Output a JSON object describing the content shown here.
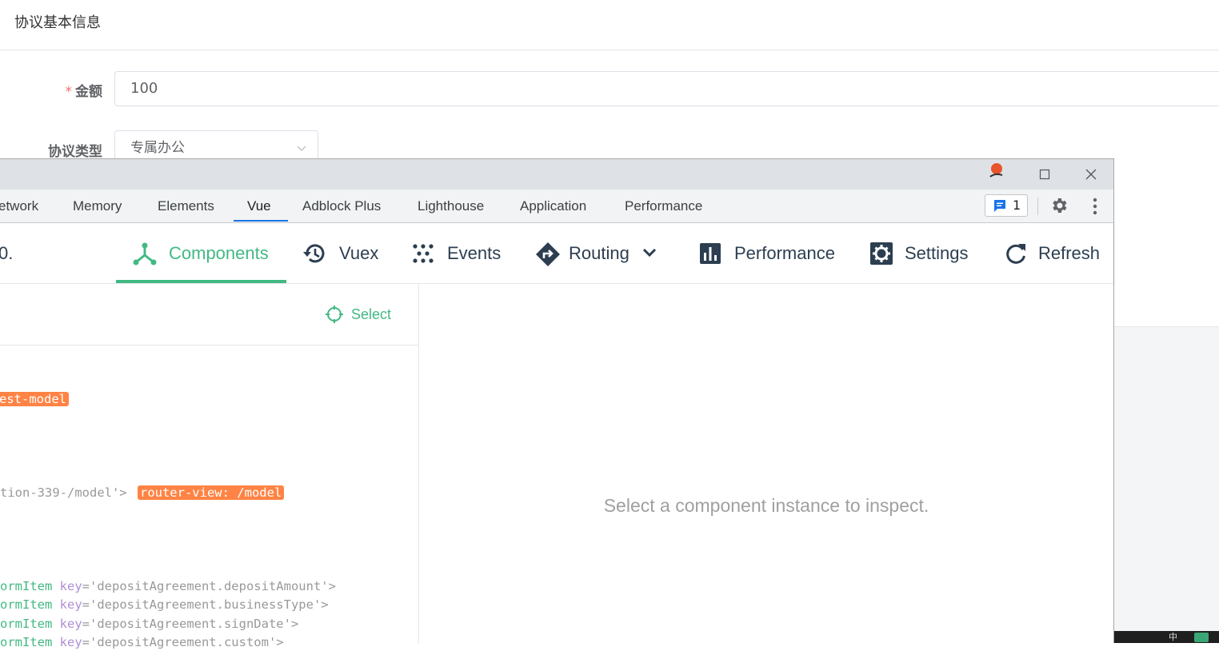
{
  "app": {
    "section_title": "协议基本信息",
    "amount_label": "金额",
    "required_mark": "*",
    "amount_value": "100",
    "agreement_type_label": "协议类型",
    "agreement_type_value": "专属办公"
  },
  "devtools": {
    "tabs": [
      {
        "label": "etwork"
      },
      {
        "label": "Memory"
      },
      {
        "label": "Elements"
      },
      {
        "label": "Vue"
      },
      {
        "label": "Adblock Plus"
      },
      {
        "label": "Lighthouse"
      },
      {
        "label": "Application"
      },
      {
        "label": "Performance"
      }
    ],
    "issues_count": "1"
  },
  "vue_toolbar": {
    "version_fragment": "0.",
    "components": "Components",
    "vuex": "Vuex",
    "events": "Events",
    "routing": "Routing",
    "performance": "Performance",
    "settings": "Settings",
    "refresh": "Refresh"
  },
  "tree": {
    "select_label": "Select",
    "line1_badge": "est-model",
    "line2_text": "tion-339-/model'>",
    "line2_badge": "router-view: /model",
    "rows": [
      {
        "name": "ormItem",
        "key": "key",
        "value": "='depositAgreement.depositAmount'>"
      },
      {
        "name": "ormItem",
        "key": "key",
        "value": "='depositAgreement.businessType'>"
      },
      {
        "name": "ormItem",
        "key": "key",
        "value": "='depositAgreement.signDate'>"
      },
      {
        "name": "ormItem",
        "key": "key",
        "value": "='depositAgreement.custom'>"
      }
    ]
  },
  "inspector": {
    "empty_message": "Select a component instance to inspect."
  },
  "taskbar": {
    "text": "中"
  },
  "colors": {
    "vue_green": "#42b983",
    "tag_orange": "#ff8344",
    "chrome_blue": "#1a73e8"
  }
}
